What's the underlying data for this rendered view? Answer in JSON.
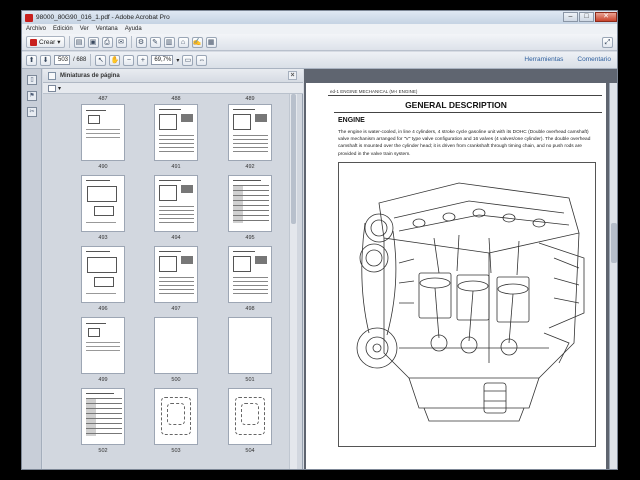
{
  "window": {
    "title": "98000_80G90_016_1.pdf - Adobe Acrobat Pro",
    "minimize": "–",
    "maximize": "□",
    "close": "✕"
  },
  "menu": [
    "Archivo",
    "Edición",
    "Ver",
    "Ventana",
    "Ayuda"
  ],
  "toolbar": {
    "create_label": "Crear",
    "icons": [
      "open-icon",
      "save-icon",
      "print-icon",
      "email-icon",
      "settings-icon",
      "comment-icon",
      "highlight-icon",
      "attach-icon",
      "edit-icon",
      "form-icon"
    ]
  },
  "navbar": {
    "current_page": "503",
    "page_count_text": "/ 688",
    "zoom": "69,7%",
    "tools_link": "Herramientas",
    "comment_link": "Comentario"
  },
  "thumbnails_panel": {
    "title": "Miniaturas de página",
    "close": "×",
    "top_labels": [
      "487",
      "488",
      "489"
    ],
    "pages": [
      "490",
      "491",
      "492",
      "493",
      "494",
      "495",
      "496",
      "497",
      "498",
      "499",
      "500",
      "501",
      "502",
      "503",
      "504"
    ]
  },
  "document": {
    "running_head": "ed-1 ENGINE MECHANICAL (M-I ENGINE)",
    "title": "GENERAL DESCRIPTION",
    "section": "ENGINE",
    "body": "The engine is water-cooled, in line 4 cylinders, 4 stroke cycle gasoline unit with its DOHC (Double overhead camshaft) valve mechanism arranged for \"V\" type valve configuration and 16 valves (4 valves/one cylinder). The double overhead camshaft is mounted over the cylinder head; it is driven from crankshaft through timing chain, and no push rods are provided in the valve train system."
  },
  "colors": {
    "accent_link": "#2d5f9e",
    "adobe_red": "#c8201e",
    "panel_bg": "#d2d7df",
    "doc_bg": "#5f6570"
  }
}
